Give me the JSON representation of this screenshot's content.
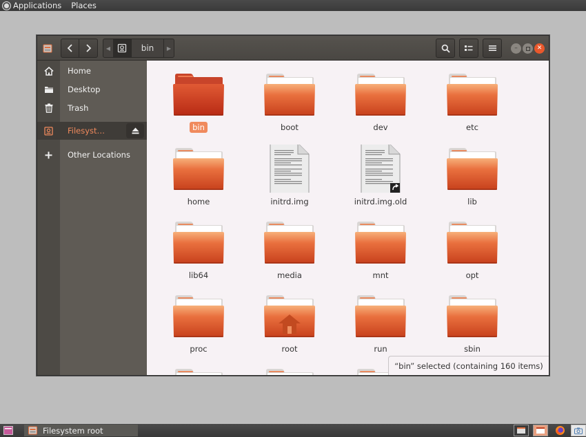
{
  "top_panel": {
    "applications_label": "Applications",
    "places_label": "Places"
  },
  "window": {
    "breadcrumb": {
      "current": "bin"
    }
  },
  "sidebar": {
    "items": [
      {
        "label": "Home",
        "icon": "home-icon"
      },
      {
        "label": "Desktop",
        "icon": "folder-icon"
      },
      {
        "label": "Trash",
        "icon": "trash-icon"
      },
      {
        "label": "Filesyst…",
        "icon": "drive-icon",
        "active": true
      },
      {
        "label": "Other Locations",
        "icon": "plus-icon"
      }
    ]
  },
  "files": [
    {
      "name": "bin",
      "type": "folder",
      "selected": true
    },
    {
      "name": "boot",
      "type": "folder"
    },
    {
      "name": "dev",
      "type": "folder"
    },
    {
      "name": "etc",
      "type": "folder"
    },
    {
      "name": "home",
      "type": "folder"
    },
    {
      "name": "initrd.img",
      "type": "file"
    },
    {
      "name": "initrd.img.old",
      "type": "file-link"
    },
    {
      "name": "lib",
      "type": "folder"
    },
    {
      "name": "lib64",
      "type": "folder"
    },
    {
      "name": "media",
      "type": "folder"
    },
    {
      "name": "mnt",
      "type": "folder"
    },
    {
      "name": "opt",
      "type": "folder"
    },
    {
      "name": "proc",
      "type": "folder"
    },
    {
      "name": "root",
      "type": "folder-home"
    },
    {
      "name": "run",
      "type": "folder"
    },
    {
      "name": "sbin",
      "type": "folder"
    }
  ],
  "status": {
    "text": "“bin” selected  (containing 160 items)"
  },
  "taskbar": {
    "task_label": "Filesystem root"
  },
  "colors": {
    "accent": "#f08a5d",
    "folder": "#e0602e",
    "panel": "#3c3b37"
  }
}
